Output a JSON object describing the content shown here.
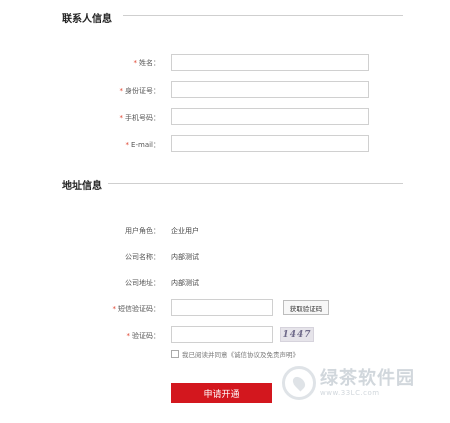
{
  "contact_section": {
    "title": "联系人信息",
    "fields": [
      {
        "label": "姓名：",
        "value": "",
        "placeholder": ""
      },
      {
        "label": "身份证号：",
        "value": "",
        "placeholder": ""
      },
      {
        "label": "手机号码：",
        "value": "",
        "placeholder": ""
      },
      {
        "label": "E-mail：",
        "value": "",
        "placeholder": ""
      }
    ]
  },
  "address_section": {
    "title": "地址信息",
    "user_role_label": "用户角色：",
    "user_role_value": "企业用户",
    "company_name_label": "公司名称：",
    "company_name_value": "内部测试",
    "company_address_label": "公司地址：",
    "company_address_value": "内部测试",
    "sms_code_label": "短信验证码：",
    "get_code_button": "获取验证码",
    "captcha_label": "验证码：",
    "captcha_text": "1447",
    "agreement_text": "我已阅读并同意《诚信协议及免责声明》"
  },
  "required_mark": "*",
  "submit_button": "申请开通",
  "watermark": {
    "name": "绿茶软件园",
    "url": "www.33LC.com"
  },
  "colors": {
    "accent": "#d3171e",
    "required": "#e0432f"
  }
}
